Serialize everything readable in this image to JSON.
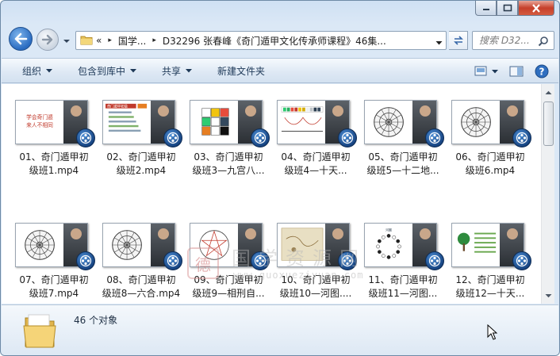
{
  "window": {
    "caption_buttons": [
      "minimize",
      "maximize",
      "close"
    ]
  },
  "navigation": {
    "back_icon": "back-arrow-icon",
    "forward_icon": "forward-arrow-icon",
    "recent_icon": "chevron-down-icon"
  },
  "address": {
    "overflow": "«",
    "segments": [
      "国学...",
      "D32296 张春峰《奇门遁甲文化传承师课程》46集..."
    ],
    "separator": "▸"
  },
  "search": {
    "placeholder": "搜索 D32..."
  },
  "toolbar": {
    "organize": "组织",
    "include_in_library": "包含到库中",
    "share": "共享",
    "new_folder": "新建文件夹"
  },
  "files": [
    {
      "line1": "01、奇门遁甲初",
      "line2": "级班1.mp4",
      "slide": "title"
    },
    {
      "line1": "02、奇门遁甲初",
      "line2": "级班2.mp4",
      "slide": "bars"
    },
    {
      "line1": "03、奇门遁甲初",
      "line2": "级班3—九宫八...",
      "slide": "grid"
    },
    {
      "line1": "04、奇门遁甲初",
      "line2": "级班4—十天...",
      "slide": "stems"
    },
    {
      "line1": "05、奇门遁甲初",
      "line2": "级班5—十二地...",
      "slide": "wheel"
    },
    {
      "line1": "06、奇门遁甲初",
      "line2": "级班6.mp4",
      "slide": "wheel"
    },
    {
      "line1": "07、奇门遁甲初",
      "line2": "级班7.mp4",
      "slide": "wheel"
    },
    {
      "line1": "08、奇门遁甲初",
      "line2": "级班8—六合.mp4",
      "slide": "wheel"
    },
    {
      "line1": "09、奇门遁甲初",
      "line2": "级班9—相刑自...",
      "slide": "star"
    },
    {
      "line1": "10、奇门遁甲初",
      "line2": "级班10—河图....",
      "slide": "map"
    },
    {
      "line1": "11、奇门遁甲初",
      "line2": "级班11—河图...",
      "slide": "dots"
    },
    {
      "line1": "12、奇门遁甲初",
      "line2": "级班12—十天...",
      "slide": "tree"
    }
  ],
  "slide_texts": {
    "title_line1": "学会奇门遁",
    "title_line2": "来人不相同",
    "bars_header": "奇门遁甲初级"
  },
  "watermark": {
    "seal": "德",
    "title": "国学资源网",
    "url": "www.guoxueziyuan.com"
  },
  "details": {
    "count_text": "46 个对象"
  },
  "colors": {
    "accent": "#2a6cc1",
    "toolbar_text": "#1e3958",
    "close_red": "#c6402b"
  }
}
